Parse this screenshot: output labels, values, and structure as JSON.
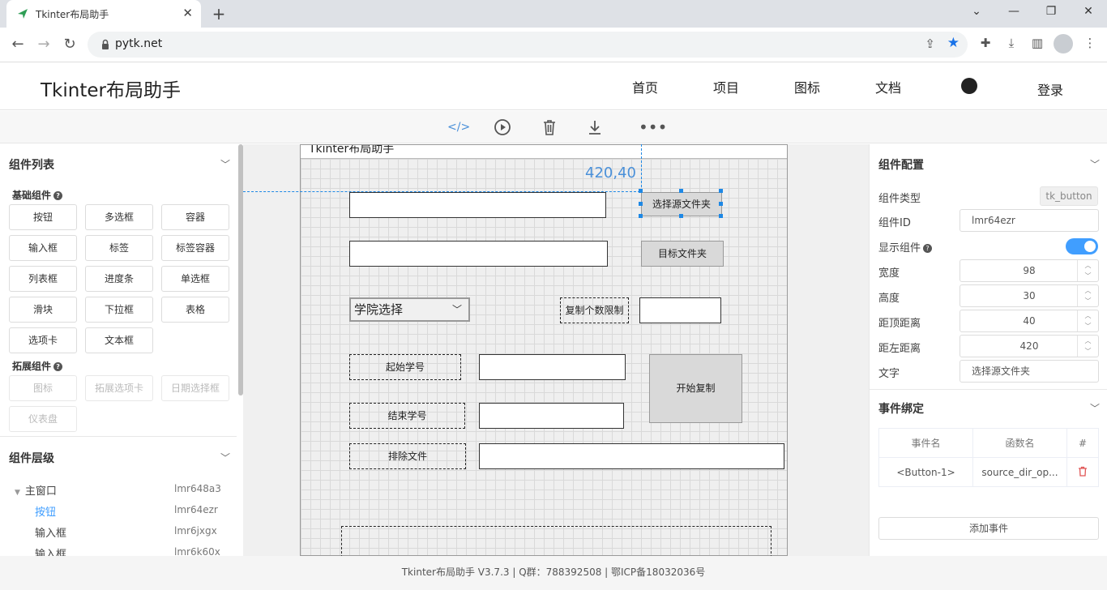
{
  "browser": {
    "tab_title": "Tkinter布局助手",
    "url": "pytk.net",
    "icons": {
      "back": "arrow-left-icon",
      "forward": "arrow-right-icon",
      "reload": "reload-icon"
    }
  },
  "site": {
    "logo": "Tkinter布局助手",
    "nav": [
      "首页",
      "项目",
      "图标",
      "文档"
    ],
    "login": "登录"
  },
  "toolbar": {
    "icons": [
      "code-icon",
      "play-icon",
      "trash-icon",
      "download-icon",
      "more-icon"
    ]
  },
  "left_panel": {
    "components_title": "组件列表",
    "basic_title": "基础组件",
    "basic": [
      "按钮",
      "多选框",
      "容器",
      "输入框",
      "标签",
      "标签容器",
      "列表框",
      "进度条",
      "单选框",
      "滑块",
      "下拉框",
      "表格",
      "选项卡",
      "文本框"
    ],
    "extended_title": "拓展组件",
    "extended": [
      "图标",
      "拓展选项卡",
      "日期选择框",
      "仪表盘"
    ],
    "hierarchy_title": "组件层级",
    "tree": [
      {
        "label": "主窗口",
        "id": "lmr648a3"
      },
      {
        "label": "按钮",
        "id": "lmr64ezr"
      },
      {
        "label": "输入框",
        "id": "lmr6jxgx"
      },
      {
        "label": "输入框",
        "id": "lmr6k60x"
      }
    ]
  },
  "canvas": {
    "window_title": "Tkinter布局助手",
    "coord": "420,40",
    "btn_select_source": "选择源文件夹",
    "btn_target": "目标文件夹",
    "combo": "学院选择",
    "label_copy_limit": "复制个数限制",
    "label_start_id": "起始学号",
    "label_end_id": "结束学号",
    "label_exclude": "排除文件",
    "btn_start_copy": "开始复制"
  },
  "right_panel": {
    "config_title": "组件配置",
    "type_label": "组件类型",
    "type_value": "tk_button",
    "id_label": "组件ID",
    "id_value": "lmr64ezr",
    "show_label": "显示组件",
    "show_on": true,
    "width_label": "宽度",
    "width_value": "98",
    "height_label": "高度",
    "height_value": "30",
    "top_label": "距顶距离",
    "top_value": "40",
    "left_label": "距左距离",
    "left_value": "420",
    "text_label": "文字",
    "text_value": "选择源文件夹",
    "events_title": "事件绑定",
    "event_col_name": "事件名",
    "event_col_func": "函数名",
    "event_col_hash": "#",
    "events": [
      {
        "name": "<Button-1>",
        "func": "source_dir_op..."
      }
    ],
    "add_event": "添加事件"
  },
  "footer": "Tkinter布局助手 V3.7.3 | Q群：788392508 | 鄂ICP备18032036号",
  "colors": {
    "accent": "#409eff",
    "guide": "#1e88e5",
    "star": "#1a73e8"
  }
}
